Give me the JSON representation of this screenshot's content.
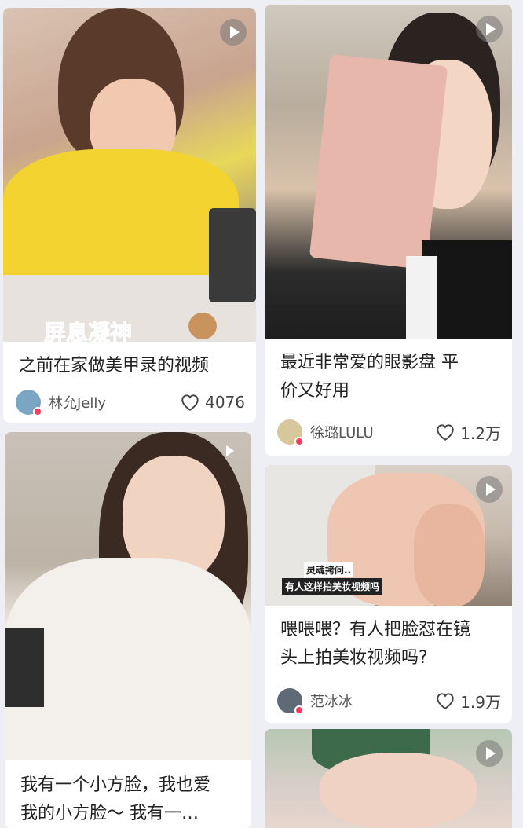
{
  "cards": [
    {
      "title": "之前在家做美甲录的视频",
      "overlay": "屏息凝神",
      "author": "林允Jelly",
      "likes": "4076"
    },
    {
      "title_line1": "最近非常爱的眼影盘 平",
      "title_line2": "价又好用",
      "author": "徐璐LULU",
      "likes": "1.2万"
    },
    {
      "title_line1": "我有一个小方脸，我也爱",
      "title_line2": "我的小方脸～ 我有一…"
    },
    {
      "title_line1": "喂喂喂？有人把脸怼在镜",
      "title_line2": "头上拍美妆视频吗?",
      "overlay_line1": "灵魂拷问..",
      "overlay_line2": "有人这样拍美妆视频吗",
      "author": "范冰冰",
      "likes": "1.9万"
    }
  ],
  "colors": {
    "background": "#eeeff4",
    "card": "#ffffff",
    "text": "#222222",
    "badge": "#ff3b5c"
  }
}
